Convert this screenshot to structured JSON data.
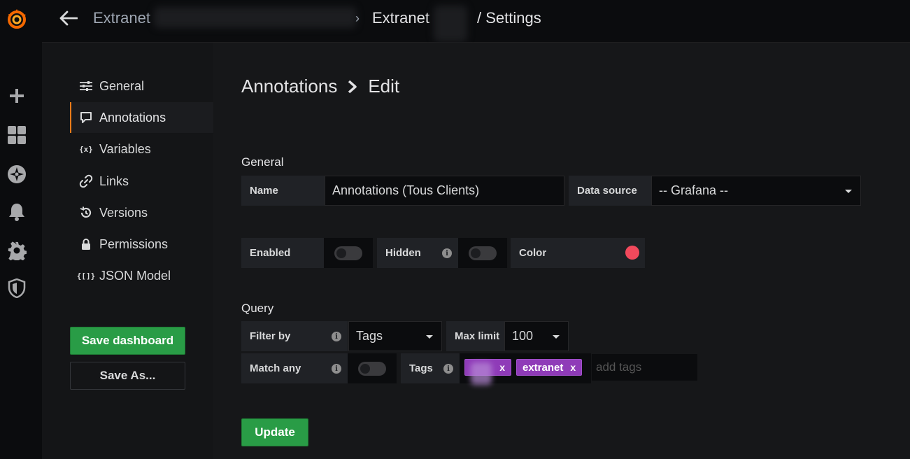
{
  "navbar": {
    "back_label": "Back",
    "crumb_folder": "Extranet",
    "crumb_separator": "›",
    "crumb_dashboard": "Extranet",
    "crumb_page": "/ Settings"
  },
  "sidemenu": {
    "icons": [
      "grafana-logo-icon",
      "plus-icon",
      "dashboards-icon",
      "explore-icon",
      "alerting-bell-icon",
      "gear-icon",
      "shield-icon"
    ]
  },
  "settings_nav": {
    "items": [
      {
        "label": "General",
        "icon": "sliders-icon"
      },
      {
        "label": "Annotations",
        "icon": "comment-icon"
      },
      {
        "label": "Variables",
        "icon": "variable-icon"
      },
      {
        "label": "Links",
        "icon": "link-icon"
      },
      {
        "label": "Versions",
        "icon": "history-icon"
      },
      {
        "label": "Permissions",
        "icon": "lock-icon"
      },
      {
        "label": "JSON Model",
        "icon": "json-icon"
      }
    ],
    "active": "Annotations",
    "save_label": "Save dashboard",
    "save_as_label": "Save As..."
  },
  "page": {
    "title": "Annotations",
    "subtitle": "Edit"
  },
  "general": {
    "heading": "General",
    "name_label": "Name",
    "name_value": "Annotations (Tous Clients)",
    "datasource_label": "Data source",
    "datasource_value": "-- Grafana --",
    "enabled_label": "Enabled",
    "hidden_label": "Hidden",
    "color_label": "Color",
    "color_value": "#f2495c"
  },
  "query": {
    "heading": "Query",
    "filter_label": "Filter by",
    "filter_value": "Tags",
    "maxlimit_label": "Max limit",
    "maxlimit_value": "100",
    "matchany_label": "Match any",
    "tags_label": "Tags",
    "tags": [
      "extranet"
    ],
    "tag_remove": "x",
    "add_tags_placeholder": "add tags"
  },
  "actions": {
    "update_label": "Update"
  },
  "colors": {
    "accent_orange": "#eb7b18",
    "primary_green": "#299c46",
    "tag_purple": "#8f3bb8"
  }
}
